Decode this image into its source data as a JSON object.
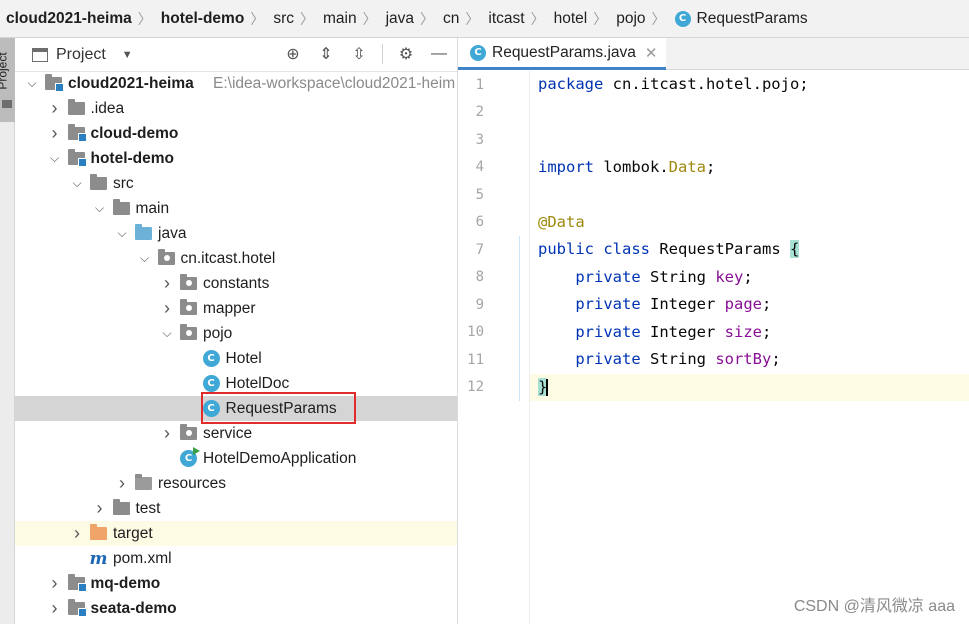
{
  "breadcrumb": {
    "items": [
      "cloud2021-heima",
      "hotel-demo",
      "src",
      "main",
      "java",
      "cn",
      "itcast",
      "hotel",
      "pojo",
      "RequestParams"
    ]
  },
  "side_tab": {
    "label": "Project"
  },
  "project_panel": {
    "title": "Project",
    "tree": [
      {
        "label": "cloud2021-heima",
        "hint": "E:\\idea-workspace\\cloud2021-heim",
        "depth": 0,
        "arrow": "down",
        "icon": "module-folder-icon",
        "bold": true
      },
      {
        "label": ".idea",
        "depth": 1,
        "arrow": "right",
        "icon": "folder-icon"
      },
      {
        "label": "cloud-demo",
        "depth": 1,
        "arrow": "right",
        "icon": "module-folder-icon",
        "bold": true
      },
      {
        "label": "hotel-demo",
        "depth": 1,
        "arrow": "down",
        "icon": "module-folder-icon",
        "bold": true
      },
      {
        "label": "src",
        "depth": 2,
        "arrow": "down",
        "icon": "folder-icon"
      },
      {
        "label": "main",
        "depth": 3,
        "arrow": "down",
        "icon": "folder-icon"
      },
      {
        "label": "java",
        "depth": 4,
        "arrow": "down",
        "icon": "source-folder-icon"
      },
      {
        "label": "cn.itcast.hotel",
        "depth": 5,
        "arrow": "down",
        "icon": "package-icon"
      },
      {
        "label": "constants",
        "depth": 6,
        "arrow": "right",
        "icon": "package-icon"
      },
      {
        "label": "mapper",
        "depth": 6,
        "arrow": "right",
        "icon": "package-icon"
      },
      {
        "label": "pojo",
        "depth": 6,
        "arrow": "down",
        "icon": "package-icon"
      },
      {
        "label": "Hotel",
        "depth": 7,
        "arrow": "",
        "icon": "class-icon"
      },
      {
        "label": "HotelDoc",
        "depth": 7,
        "arrow": "",
        "icon": "class-icon"
      },
      {
        "label": "RequestParams",
        "depth": 7,
        "arrow": "",
        "icon": "class-icon",
        "selected": true
      },
      {
        "label": "service",
        "depth": 6,
        "arrow": "right",
        "icon": "package-icon"
      },
      {
        "label": "HotelDemoApplication",
        "depth": 6,
        "arrow": "",
        "icon": "spring-boot-class-icon"
      },
      {
        "label": "resources",
        "depth": 4,
        "arrow": "right",
        "icon": "resources-folder-icon"
      },
      {
        "label": "test",
        "depth": 3,
        "arrow": "right",
        "icon": "folder-icon"
      },
      {
        "label": "target",
        "depth": 2,
        "arrow": "right",
        "icon": "excluded-folder-icon"
      },
      {
        "label": "pom.xml",
        "depth": 2,
        "arrow": "",
        "icon": "maven-icon"
      },
      {
        "label": "mq-demo",
        "depth": 1,
        "arrow": "right",
        "icon": "module-folder-icon",
        "bold": true
      },
      {
        "label": "seata-demo",
        "depth": 1,
        "arrow": "right",
        "icon": "module-folder-icon",
        "bold": true
      }
    ]
  },
  "editor": {
    "tab_label": "RequestParams.java",
    "line_numbers": [
      "1",
      "2",
      "3",
      "4",
      "5",
      "6",
      "7",
      "8",
      "9",
      "10",
      "11",
      "12"
    ],
    "code": {
      "l1_kw": "package",
      "l1_rest": " cn.itcast.hotel.pojo;",
      "l4_kw": "import",
      "l4_mid": " lombok.",
      "l4_ann": "Data",
      "l4_end": ";",
      "l6_ann": "@Data",
      "l7_kw1": "public",
      "l7_kw2": "class",
      "l7_name": " RequestParams ",
      "l7_brace": "{",
      "fields": [
        {
          "kw": "private",
          "type": " String ",
          "name": "key",
          "end": ";"
        },
        {
          "kw": "private",
          "type": " Integer ",
          "name": "page",
          "end": ";"
        },
        {
          "kw": "private",
          "type": " Integer ",
          "name": "size",
          "end": ";"
        },
        {
          "kw": "private",
          "type": " String ",
          "name": "sortBy",
          "end": ";"
        }
      ],
      "l12_brace": "}"
    }
  },
  "watermark": "CSDN @清风微凉 aaa",
  "colors": {
    "keyword": "#0033b3",
    "annotation": "#9e880d",
    "field": "#871094",
    "selection_box": "#e02c2c"
  }
}
